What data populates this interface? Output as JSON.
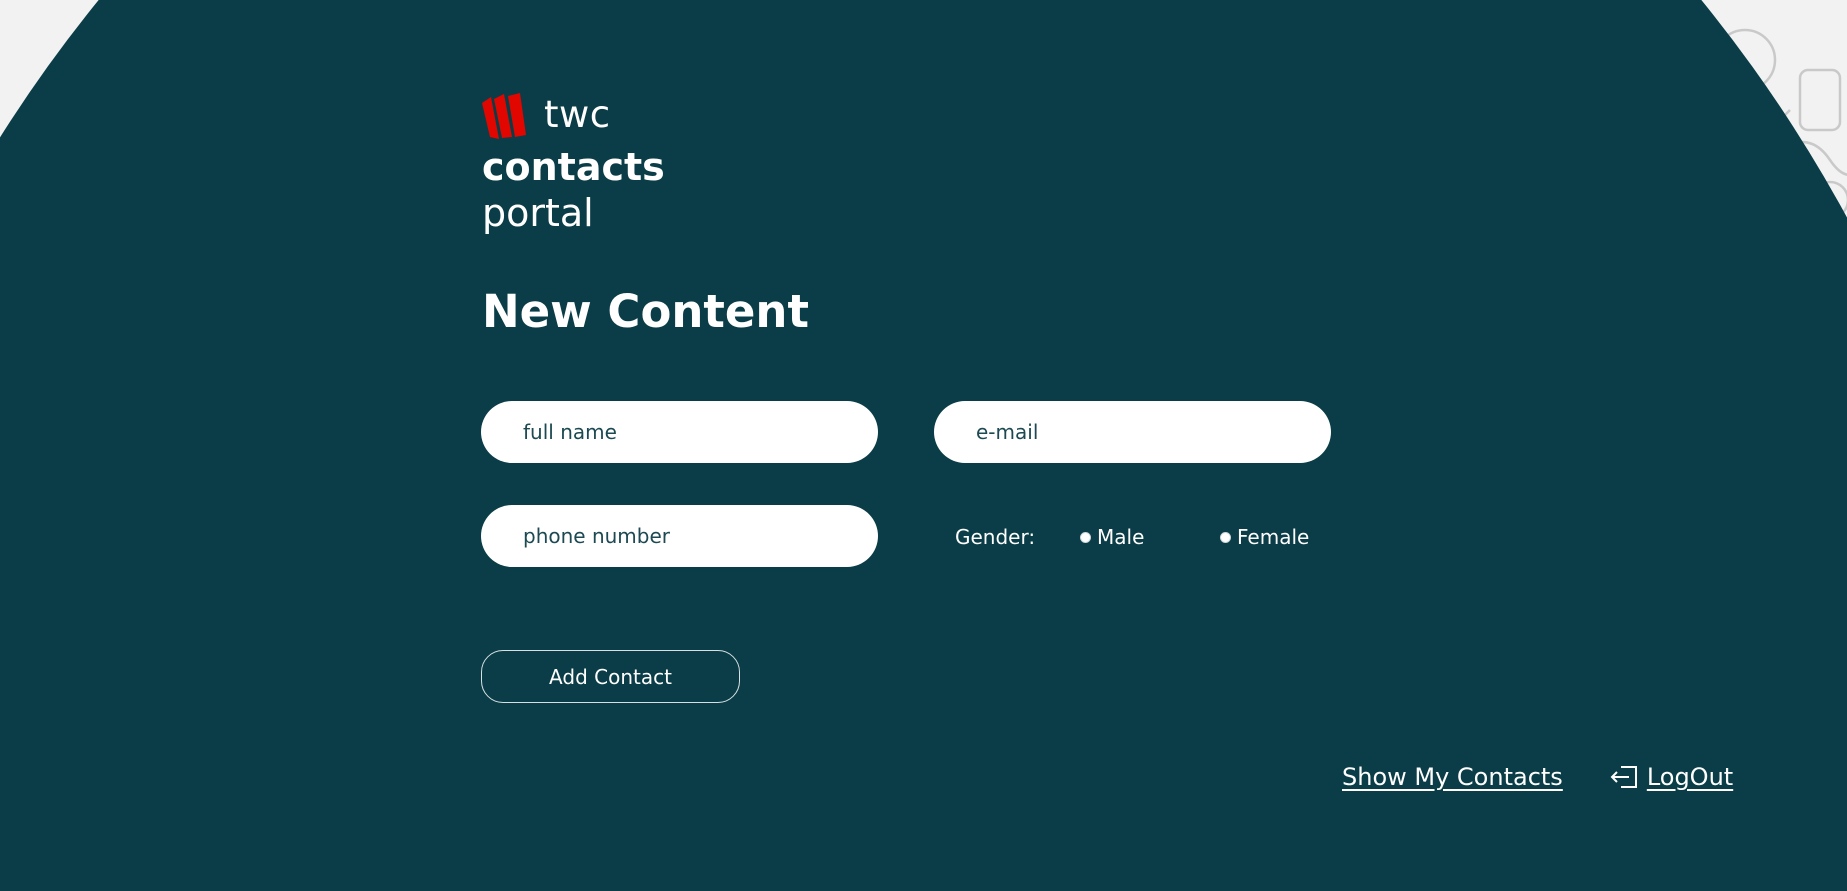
{
  "brand": {
    "name": "twc",
    "line1": "contacts",
    "line2": "portal",
    "logo_color": "#e10600"
  },
  "page": {
    "title": "New Content",
    "background_color": "#0a3d47"
  },
  "form": {
    "full_name": {
      "placeholder": "full name",
      "value": ""
    },
    "email": {
      "placeholder": "e-mail",
      "value": ""
    },
    "phone": {
      "placeholder": "phone number",
      "value": ""
    },
    "gender": {
      "label": "Gender:",
      "options": [
        "Male",
        "Female"
      ],
      "selected": null
    },
    "submit_label": "Add Contact"
  },
  "footer_links": {
    "show_contacts": "Show My Contacts",
    "logout": "LogOut",
    "logout_icon": "logout-icon"
  }
}
